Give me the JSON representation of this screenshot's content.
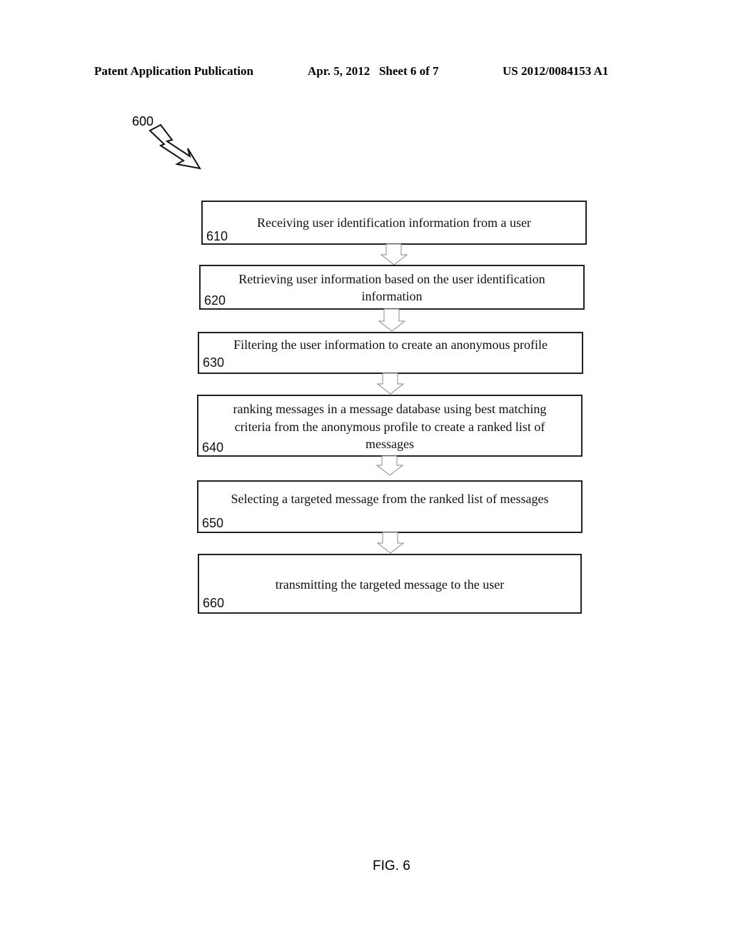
{
  "header": {
    "left": "Patent Application Publication",
    "middle": "Apr. 5, 2012   Sheet 6 of 7",
    "right": "US 2012/0084153 A1"
  },
  "figure_ref": "600",
  "steps": [
    {
      "number": "610",
      "text": "Receiving user identification information from a user"
    },
    {
      "number": "620",
      "text_lines": [
        "Retrieving user information based on the user identification",
        "information"
      ]
    },
    {
      "number": "630",
      "text": "Filtering the user information to create an anonymous profile"
    },
    {
      "number": "640",
      "text_lines": [
        "ranking messages in a message database using best matching",
        "criteria from the anonymous profile to create a ranked list of",
        "messages"
      ]
    },
    {
      "number": "650",
      "text": "Selecting a targeted message from the ranked list of messages"
    },
    {
      "number": "660",
      "text": "transmitting the targeted message to the user"
    }
  ],
  "figure_caption": "FIG. 6"
}
